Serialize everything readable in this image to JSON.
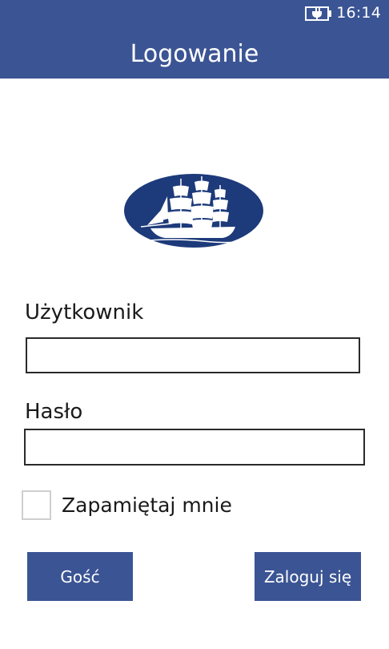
{
  "status_bar": {
    "time": "16:14",
    "battery_icon": "battery-charging-icon"
  },
  "header": {
    "title": "Logowanie"
  },
  "logo": {
    "icon": "sailing-ship-logo"
  },
  "form": {
    "username_label": "Użytkownik",
    "username_value": "",
    "password_label": "Hasło",
    "password_value": "",
    "remember_label": "Zapamiętaj mnie",
    "remember_checked": false
  },
  "buttons": {
    "guest_label": "Gość",
    "login_label": "Zaloguj się"
  },
  "colors": {
    "accent": "#3b5494",
    "logo": "#1d3a7a",
    "background": "#ffffff"
  }
}
